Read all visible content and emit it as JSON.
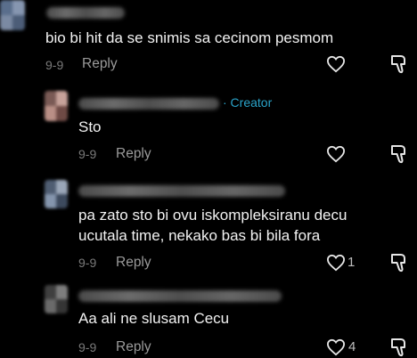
{
  "comments": [
    {
      "text": "bio bi hit da se snimis sa cecinom pesmom",
      "date": "9-9",
      "reply_label": "Reply",
      "likes": "",
      "icons": {
        "like": "heart-icon",
        "dislike": "dislike-icon"
      }
    },
    {
      "creator_tag": "· Creator",
      "text": "Sto",
      "date": "9-9",
      "reply_label": "Reply",
      "likes": "",
      "icons": {
        "like": "heart-icon",
        "dislike": "dislike-icon"
      }
    },
    {
      "text_lines": [
        "pa zato sto bi ovu iskompleksiranu decu",
        "ucutala time, nekako bas bi bila fora"
      ],
      "date": "9-9",
      "reply_label": "Reply",
      "likes": "1",
      "icons": {
        "like": "heart-icon",
        "dislike": "dislike-icon"
      }
    },
    {
      "text": "Aa ali ne slusam Cecu",
      "date": "9-9",
      "reply_label": "Reply",
      "likes": "4",
      "icons": {
        "like": "heart-icon",
        "dislike": "dislike-icon"
      }
    }
  ],
  "colors": {
    "background": "#000000",
    "creator": "#2aa3c9",
    "meta": "#7a7a7a"
  }
}
